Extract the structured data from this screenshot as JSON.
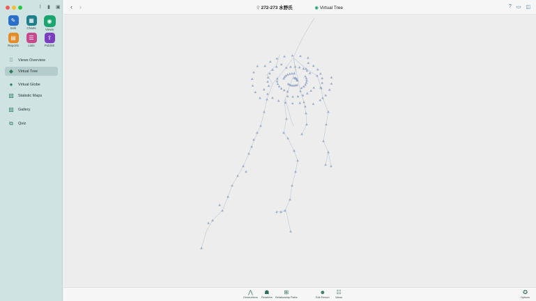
{
  "window": {
    "title_pedigree": "272-273 水野氏",
    "title_view": "Virtual Tree"
  },
  "colors": {
    "sidebar_bg": "#cfe3e3",
    "accent": "#1a9a6a",
    "tree_line": "#b8c9d9",
    "tree_node": "#9fb2cc"
  },
  "sidebar": {
    "apps": [
      {
        "label": "Edit",
        "icon": "pencil-icon",
        "color": "#2c6fc9"
      },
      {
        "label": "Charts",
        "icon": "chart-icon",
        "color": "#1f7f8a"
      },
      {
        "label": "Views",
        "icon": "eye-icon",
        "color": "#1aa56f"
      },
      {
        "label": "Reports",
        "icon": "report-icon",
        "color": "#e48b2a"
      },
      {
        "label": "Lists",
        "icon": "list-icon",
        "color": "#c84a8e"
      },
      {
        "label": "Publish",
        "icon": "publish-icon",
        "color": "#7a3fc0"
      }
    ],
    "nav": [
      {
        "label": "Views Overview",
        "icon": "grid-icon"
      },
      {
        "label": "Virtual Tree",
        "icon": "cube-icon"
      },
      {
        "label": "Virtual Globe",
        "icon": "globe-icon"
      },
      {
        "label": "Statistic Maps",
        "icon": "map-icon"
      },
      {
        "label": "Gallery",
        "icon": "gallery-icon"
      },
      {
        "label": "Quiz",
        "icon": "quiz-icon"
      }
    ]
  },
  "toolbar": {
    "generations": "Generations",
    "relatives": "Relatives",
    "relationship_paths": "Relationship Paths",
    "edit_person": "Edit Person",
    "views": "Views",
    "options": "Options"
  }
}
